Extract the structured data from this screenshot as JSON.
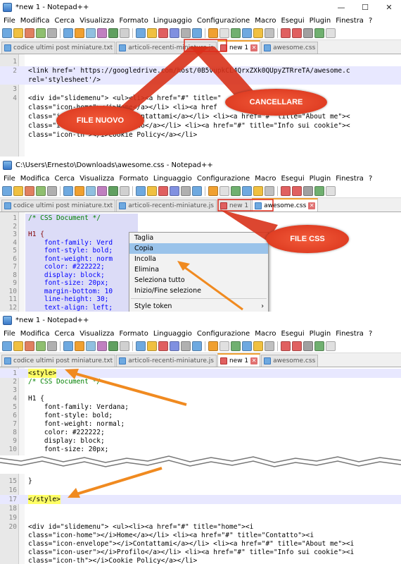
{
  "win1": {
    "title": "*new 1 - Notepad++",
    "menu": [
      "File",
      "Modifica",
      "Cerca",
      "Visualizza",
      "Formato",
      "Linguaggio",
      "Configurazione",
      "Macro",
      "Esegui",
      "Plugin",
      "Finestra",
      "?"
    ],
    "tabs": [
      "codice ultimi post miniature.txt",
      "articoli-recenti-miniature.js",
      "new 1",
      "awesome.css"
    ],
    "lines": [
      {
        "n": "1",
        "t": ""
      },
      {
        "n": "2",
        "t": "<link href=' https://googledrive.com/host/0B5vupkCL4QrxZXk0QUpyZTRreTA/awesome.c"
      },
      {
        "n": "",
        "t": "rel='stylesheet'/>"
      },
      {
        "n": "3",
        "t": ""
      },
      {
        "n": "4",
        "t": "<div id=\"slidemenu\"> <ul><li><a href=\"#\" title=\""
      },
      {
        "n": "",
        "t": "class=\"icon-home\"></i>Home</a></li> <li><a href"
      },
      {
        "n": "",
        "t": "class=\"icon-envelope\"></i>Contattami</a></li> <li><a href=\"#\" title=\"About me\"><"
      },
      {
        "n": "",
        "t": "class=\"icon-user\"></i>Profilo</a></li> <li><a href=\"#\" title=\"Info sui cookie\"><"
      },
      {
        "n": "",
        "t": "class=\"icon-th\"></i>Cookie Policy</a></li>"
      }
    ],
    "callout_new": "FILE NUOVO",
    "callout_delete": "CANCELLARE"
  },
  "win2": {
    "title": "C:\\Users\\Ernesto\\Downloads\\awesome.css - Notepad++",
    "menu": [
      "File",
      "Modifica",
      "Cerca",
      "Visualizza",
      "Formato",
      "Linguaggio",
      "Configurazione",
      "Macro",
      "Esegui",
      "Plugin",
      "Finestra",
      "?"
    ],
    "tabs": [
      "codice ultimi post miniature.txt",
      "articoli-recenti-miniature.js",
      "new 1",
      "awesome.css"
    ],
    "lines": [
      {
        "n": "1",
        "t": "/* CSS Document */"
      },
      {
        "n": "2",
        "t": ""
      },
      {
        "n": "3",
        "t": "H1 {"
      },
      {
        "n": "4",
        "t": "    font-family: Verd"
      },
      {
        "n": "5",
        "t": "    font-style: bold;"
      },
      {
        "n": "6",
        "t": "    font-weight: norm"
      },
      {
        "n": "7",
        "t": "    color: #222222;"
      },
      {
        "n": "8",
        "t": "    display: block;"
      },
      {
        "n": "9",
        "t": "    font-size: 20px;"
      },
      {
        "n": "10",
        "t": "    margin-bottom: 10"
      },
      {
        "n": "11",
        "t": "    line-height: 30;"
      },
      {
        "n": "12",
        "t": "    text-align: left;"
      }
    ],
    "context_menu": [
      "Taglia",
      "Copia",
      "Incolla",
      "Elimina",
      "Seleziona tutto",
      "Inizio/Fine selezione",
      "Style token"
    ],
    "callout_css": "FILE CSS"
  },
  "win3": {
    "title": "*new 1 - Notepad++",
    "menu": [
      "File",
      "Modifica",
      "Cerca",
      "Visualizza",
      "Formato",
      "Linguaggio",
      "Configurazione",
      "Macro",
      "Esegui",
      "Plugin",
      "Finestra",
      "?"
    ],
    "tabs": [
      "codice ultimi post miniature.txt",
      "articoli-recenti-miniature.js",
      "new 1",
      "awesome.css"
    ],
    "lines": [
      {
        "n": "1",
        "t": "<style>"
      },
      {
        "n": "2",
        "t": "/* CSS Document */"
      },
      {
        "n": "3",
        "t": ""
      },
      {
        "n": "4",
        "t": "H1 {"
      },
      {
        "n": "5",
        "t": "    font-family: Verdana;"
      },
      {
        "n": "6",
        "t": "    font-style: bold;"
      },
      {
        "n": "7",
        "t": "    font-weight: normal;"
      },
      {
        "n": "8",
        "t": "    color: #222222;"
      },
      {
        "n": "9",
        "t": "    display: block;"
      },
      {
        "n": "10",
        "t": "    font-size: 20px;"
      }
    ],
    "bottom_lines": [
      {
        "n": "15",
        "t": "}"
      },
      {
        "n": "16",
        "t": ""
      },
      {
        "n": "17",
        "t": "</style>"
      },
      {
        "n": "18",
        "t": ""
      },
      {
        "n": "19",
        "t": ""
      },
      {
        "n": "20",
        "t": "<div id=\"slidemenu\"> <ul><li><a href=\"#\" title=\"home\"><i"
      },
      {
        "n": "",
        "t": "class=\"icon-home\"></i>Home</a></li> <li><a href=\"#\" title=\"Contatto\"><i"
      },
      {
        "n": "",
        "t": "class=\"icon-envelope\"></i>Contattami</a></li> <li><a href=\"#\" title=\"About me\"><i"
      },
      {
        "n": "",
        "t": "class=\"icon-user\"></i>Profilo</a></li> <li><a href=\"#\" title=\"Info sui cookie\"><i"
      },
      {
        "n": "",
        "t": "class=\"icon-th\"></i>Cookie Policy</a></li>"
      }
    ]
  },
  "window_controls": [
    "—",
    "☐",
    "✕"
  ],
  "colors": {
    "callout": "#e0401f",
    "arrow": "#f08a20",
    "highlight": "#ffff66",
    "tab_active": "#f0a030"
  }
}
